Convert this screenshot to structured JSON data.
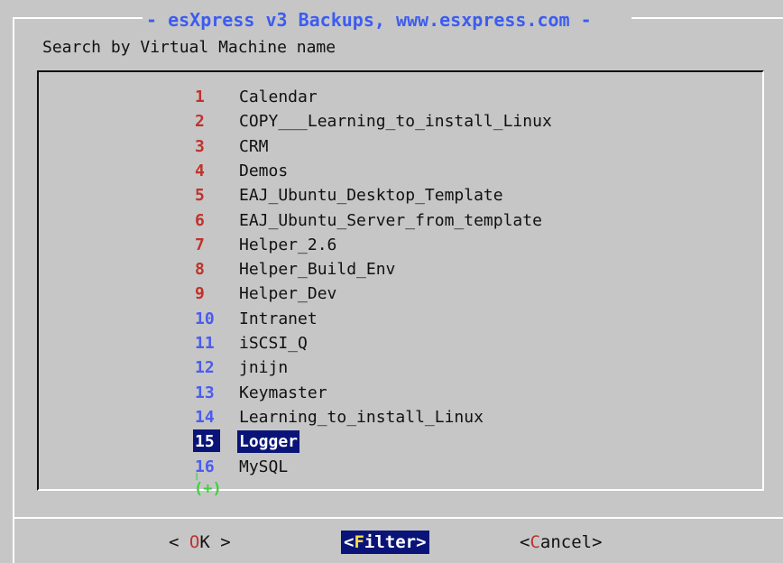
{
  "dialog": {
    "title": "- esXpress v3 Backups, www.esxpress.com -",
    "prompt": "Search by Virtual Machine name"
  },
  "list": {
    "items": [
      {
        "num": "1",
        "label": "Calendar"
      },
      {
        "num": "2",
        "label": "COPY___Learning_to_install_Linux"
      },
      {
        "num": "3",
        "label": "CRM"
      },
      {
        "num": "4",
        "label": "Demos"
      },
      {
        "num": "5",
        "label": "EAJ_Ubuntu_Desktop_Template"
      },
      {
        "num": "6",
        "label": "EAJ_Ubuntu_Server_from_template"
      },
      {
        "num": "7",
        "label": "Helper_2.6"
      },
      {
        "num": "8",
        "label": "Helper_Build_Env"
      },
      {
        "num": "9",
        "label": "Helper_Dev"
      },
      {
        "num": "10",
        "label": "Intranet"
      },
      {
        "num": "11",
        "label": "iSCSI_Q"
      },
      {
        "num": "12",
        "label": "jnijn"
      },
      {
        "num": "13",
        "label": "Keymaster"
      },
      {
        "num": "14",
        "label": "Learning_to_install_Linux"
      },
      {
        "num": "15",
        "label": "Logger"
      },
      {
        "num": "16",
        "label": "MySQL"
      }
    ],
    "selected_num": "15",
    "more_indicator": "(+)"
  },
  "buttons": {
    "ok": {
      "pre": "<  ",
      "hot": "O",
      "rest": "K  >"
    },
    "filter": {
      "pre": "<",
      "hot": "F",
      "rest": "ilter>"
    },
    "cancel": {
      "pre": "<",
      "hot": "C",
      "rest": "ancel>"
    }
  },
  "colors": {
    "background": "#c6c6c6",
    "title": "#3c5cf0",
    "number_red": "#c0322c",
    "number_blue": "#4a5cf0",
    "selection": "#0a1478",
    "more_indicator": "#3ad23a"
  }
}
